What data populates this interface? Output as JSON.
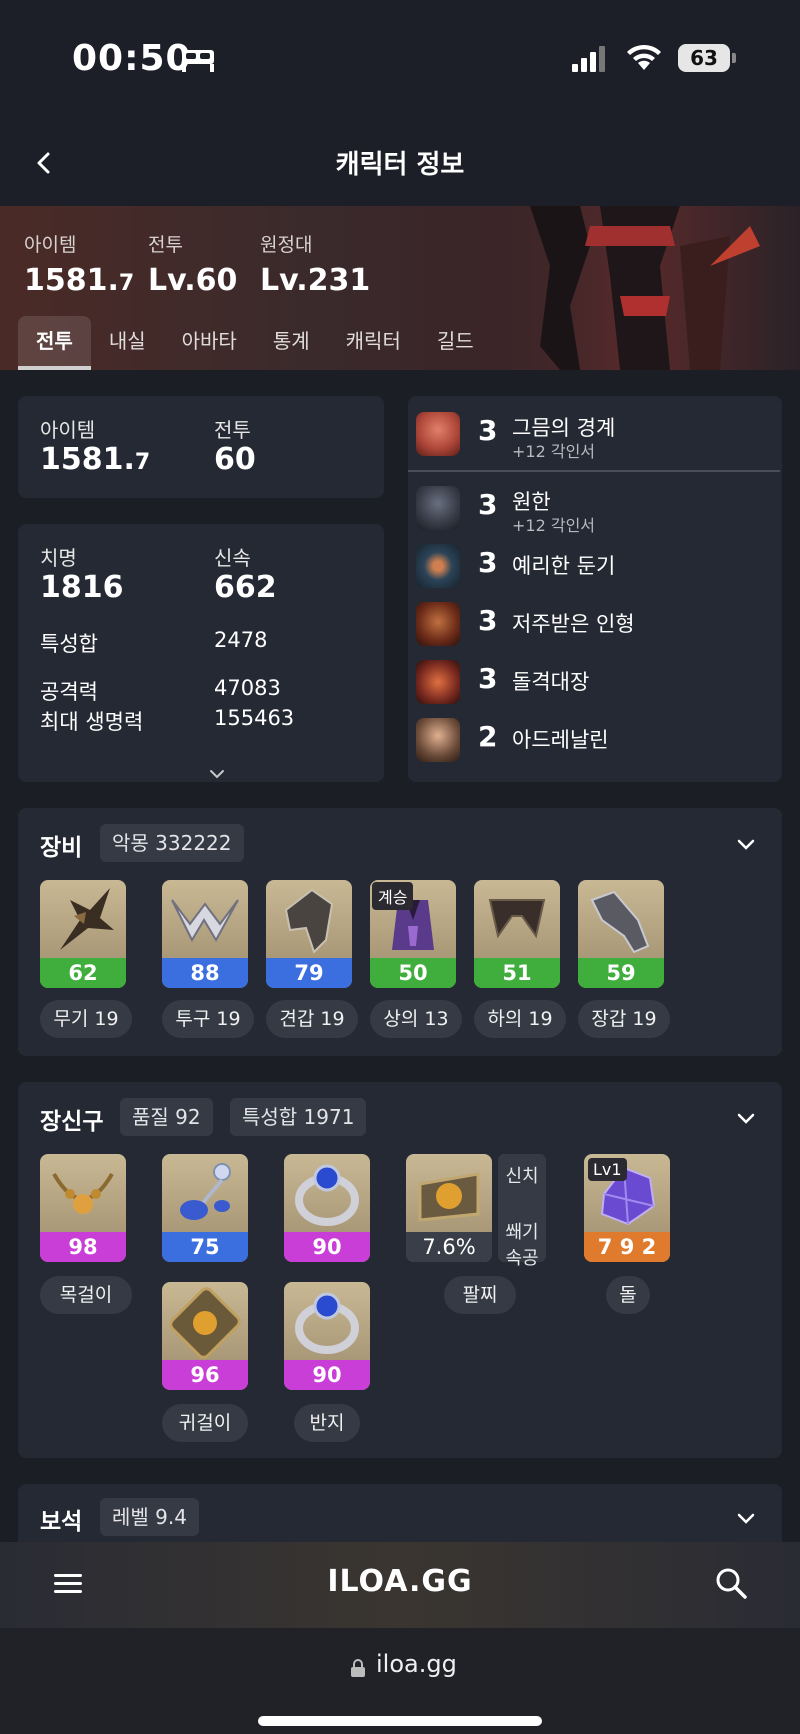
{
  "status_bar": {
    "time": "00:50",
    "battery": "63"
  },
  "header": {
    "title": "캐릭터 정보"
  },
  "hero": {
    "stats": [
      {
        "label": "아이템",
        "value_main": "1581.",
        "value_small": "7"
      },
      {
        "label": "전투",
        "value_main": "Lv.60",
        "value_small": ""
      },
      {
        "label": "원정대",
        "value_main": "Lv.231",
        "value_small": ""
      }
    ],
    "tabs": [
      "전투",
      "내실",
      "아바타",
      "통계",
      "캐릭터",
      "길드"
    ],
    "active_tab": "전투"
  },
  "summary": {
    "item_label": "아이템",
    "item_main": "1581.",
    "item_small": "7",
    "combat_label": "전투",
    "combat_value": "60"
  },
  "stats": {
    "crit_label": "치명",
    "crit_value": "1816",
    "swift_label": "신속",
    "swift_value": "662",
    "total_label": "특성합",
    "total_value": "2478",
    "attack_label": "공격력",
    "attack_value": "47083",
    "hp_label": "최대 생명력",
    "hp_value": "155463"
  },
  "engravings": [
    {
      "level": "3",
      "name": "그믐의 경계",
      "sub": "+12 각인서",
      "color": "#b0483a"
    },
    {
      "level": "3",
      "name": "원한",
      "sub": "+12 각인서",
      "color": "#3a3e4a"
    },
    {
      "level": "3",
      "name": "예리한 둔기",
      "sub": "",
      "color": "#2c4458"
    },
    {
      "level": "3",
      "name": "저주받은 인형",
      "sub": "",
      "color": "#6a2a18"
    },
    {
      "level": "3",
      "name": "돌격대장",
      "sub": "",
      "color": "#7a2a20"
    },
    {
      "level": "2",
      "name": "아드레날린",
      "sub": "",
      "color": "#6a4a38"
    }
  ],
  "equipment": {
    "title": "장비",
    "pill": "악몽 332222",
    "items": [
      {
        "value": "62",
        "label": "무기 19",
        "bar_color": "#3fae3c",
        "badge": ""
      },
      {
        "value": "88",
        "label": "투구 19",
        "bar_color": "#3b6fe0",
        "badge": ""
      },
      {
        "value": "79",
        "label": "견갑 19",
        "bar_color": "#3b6fe0",
        "badge": ""
      },
      {
        "value": "50",
        "label": "상의 13",
        "bar_color": "#3fae3c",
        "badge": "계승"
      },
      {
        "value": "51",
        "label": "하의 19",
        "bar_color": "#3fae3c",
        "badge": ""
      },
      {
        "value": "59",
        "label": "장갑 19",
        "bar_color": "#3fae3c",
        "badge": ""
      }
    ]
  },
  "accessories": {
    "title": "장신구",
    "pill_quality": "품질 92",
    "pill_stat": "특성합 1971",
    "necklace": {
      "value": "98",
      "label": "목걸이",
      "bar_color": "#c93ed6"
    },
    "earring_top": {
      "value": "75",
      "bar_color": "#3b6fe0"
    },
    "earring_bottom": {
      "value": "96",
      "label": "귀걸이",
      "bar_color": "#c93ed6"
    },
    "ring_top": {
      "value": "90",
      "bar_color": "#c93ed6"
    },
    "ring_bottom": {
      "value": "90",
      "label": "반지",
      "bar_color": "#c93ed6"
    },
    "bracelet": {
      "value": "7.6%",
      "label": "팔찌",
      "side_top": "신치",
      "side_bottom_1": "쐐기",
      "side_bottom_2": "속공"
    },
    "stone": {
      "value": "7 9 2",
      "label": "돌",
      "badge": "Lv1",
      "bar_color": "#e07a2c"
    }
  },
  "gems": {
    "title": "보석",
    "pill": "레벨 9.4"
  },
  "bottom_bar": {
    "logo": "ILOA.GG"
  },
  "url_bar": {
    "url": "iloa.gg"
  }
}
